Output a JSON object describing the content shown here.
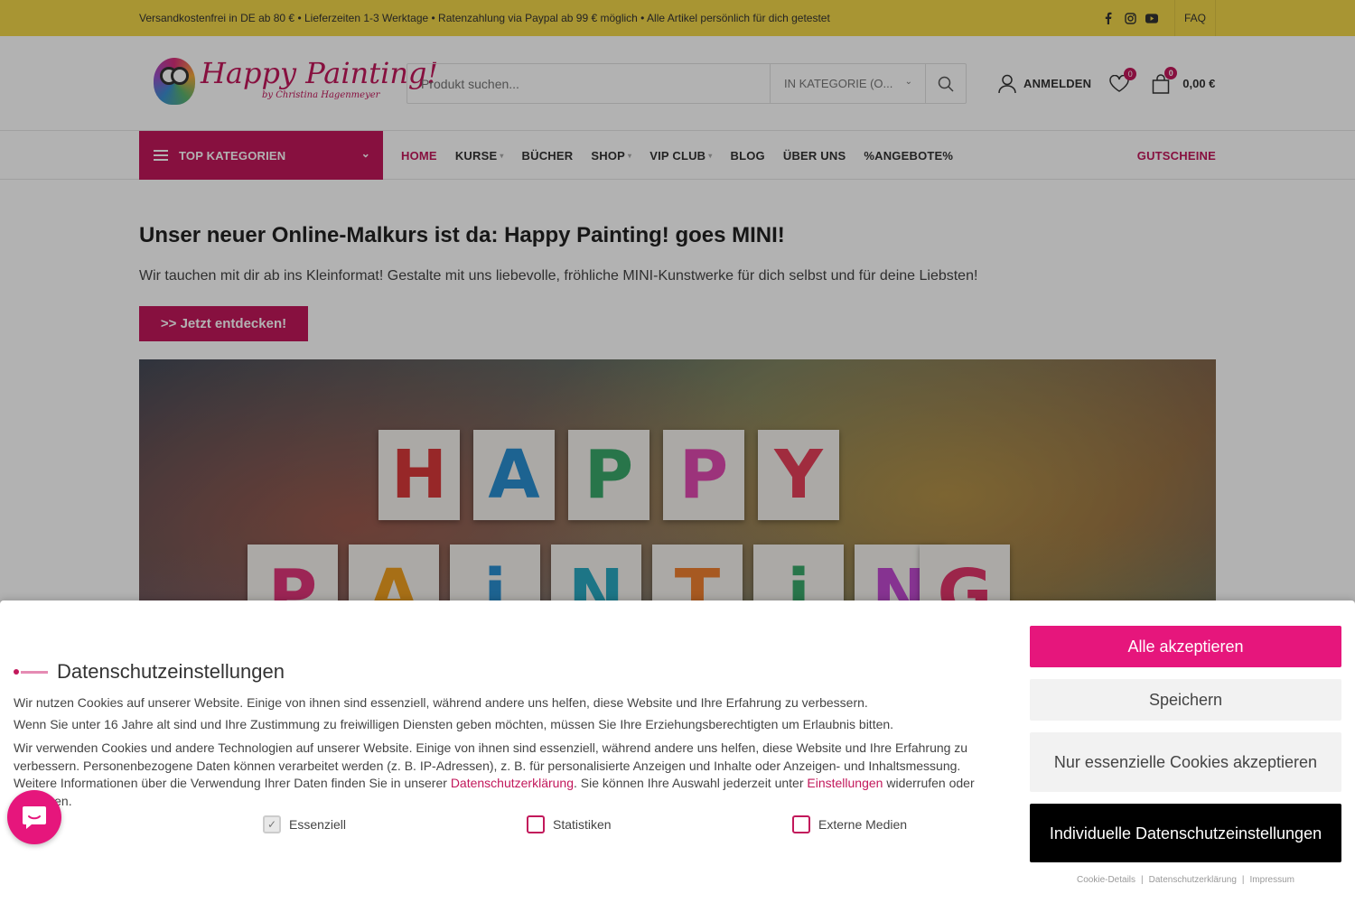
{
  "topbar": {
    "notice": "Versandkostenfrei in DE ab 80 € • Lieferzeiten 1-3 Werktage • Ratenzahlung via Paypal ab 99 € möglich • Alle Artikel persönlich für dich getestet",
    "social_icons": [
      "facebook-icon",
      "instagram-icon",
      "youtube-icon"
    ],
    "faq": "FAQ"
  },
  "header": {
    "logo_text": "Happy Painting!",
    "logo_subtext": "by Christina Hagenmeyer",
    "search_placeholder": "Produkt suchen...",
    "category_select": "IN KATEGORIE (O...",
    "login": "ANMELDEN",
    "wishlist_count": "0",
    "cart_count": "0",
    "cart_total": "0,00 €"
  },
  "nav": {
    "top_categories": "TOP KATEGORIEN",
    "items": [
      {
        "label": "HOME",
        "active": true,
        "dropdown": false
      },
      {
        "label": "KURSE",
        "active": false,
        "dropdown": true
      },
      {
        "label": "BÜCHER",
        "active": false,
        "dropdown": false
      },
      {
        "label": "SHOP",
        "active": false,
        "dropdown": true
      },
      {
        "label": "VIP CLUB",
        "active": false,
        "dropdown": true
      },
      {
        "label": "BLOG",
        "active": false,
        "dropdown": false
      },
      {
        "label": "ÜBER UNS",
        "active": false,
        "dropdown": false
      },
      {
        "label": "%ANGEBOTE%",
        "active": false,
        "dropdown": false
      }
    ],
    "gift": "GUTSCHEINE"
  },
  "main": {
    "headline": "Unser neuer Online-Malkurs ist da: Happy Painting! goes MINI!",
    "lead": "Wir tauchen mit dir ab ins Kleinformat! Gestalte mit uns liebevolle, fröhliche MINI-Kunstwerke für dich selbst und für deine Liebsten!",
    "cta": ">> Jetzt entdecken!",
    "hero_letters_row1": [
      "H",
      "A",
      "P",
      "P",
      "Y"
    ],
    "hero_letters_row2": [
      "P",
      "A",
      "i",
      "N",
      "T",
      "i",
      "N",
      "G"
    ]
  },
  "cookie": {
    "title": "Datenschutzeinstellungen",
    "p1": "Wir nutzen Cookies auf unserer Website. Einige von ihnen sind essenziell, während andere uns helfen, diese Website und Ihre Erfahrung zu verbessern.",
    "p2": "Wenn Sie unter 16 Jahre alt sind und Ihre Zustimmung zu freiwilligen Diensten geben möchten, müssen Sie Ihre Erziehungsberechtigten um Erlaubnis bitten.",
    "p3_a": "Wir verwenden Cookies und andere Technologien auf unserer Website. Einige von ihnen sind essenziell, während andere uns helfen, diese Website und Ihre Erfahrung zu verbessern. Personenbezogene Daten können verarbeitet werden (z. B. IP-Adressen), z. B. für personalisierte Anzeigen und Inhalte oder Anzeigen- und Inhaltsmessung. Weitere Informationen über die Verwendung Ihrer Daten finden Sie in unserer ",
    "p3_link1": "Datenschutzerklärung",
    "p3_b": ". Sie können Ihre Auswahl jederzeit unter ",
    "p3_link2": "Einstellungen",
    "p3_c": " widerrufen oder anpassen.",
    "checkboxes": [
      {
        "label": "Essenziell",
        "checked": true
      },
      {
        "label": "Statistiken",
        "checked": false
      },
      {
        "label": "Externe Medien",
        "checked": false
      }
    ],
    "btn_accept": "Alle akzeptieren",
    "btn_save": "Speichern",
    "btn_essential": "Nur essenzielle Cookies akzeptieren",
    "btn_individual": "Individuelle Datenschutzeinstellungen",
    "link_details": "Cookie-Details",
    "link_privacy": "Datenschutzerklärung",
    "link_imprint": "Impressum",
    "link_sep": "|"
  },
  "colors": {
    "topbar": "#f1d64a",
    "brand": "#c2185b",
    "accept": "#e6167c"
  }
}
